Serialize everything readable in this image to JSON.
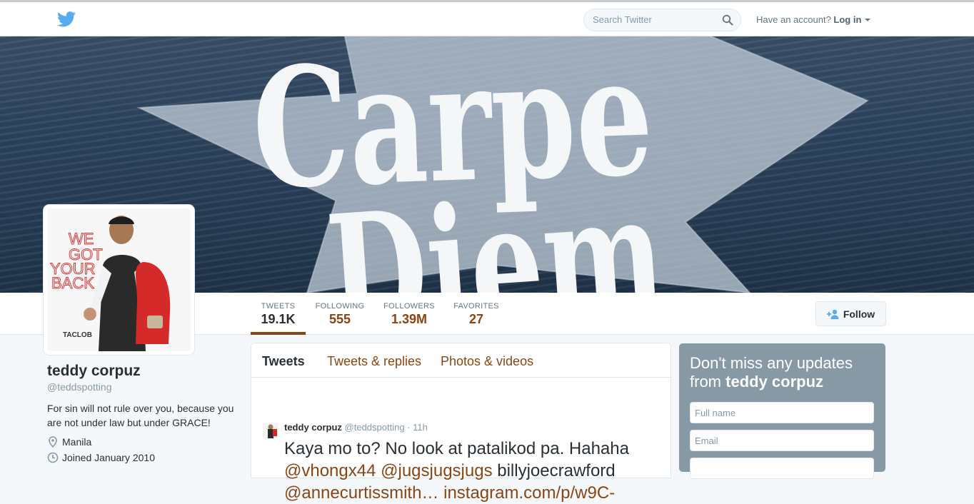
{
  "topbar": {
    "search_placeholder": "Search Twitter",
    "account_prompt": "Have an account?",
    "login_label": "Log in",
    "brand_color": "#55acee"
  },
  "banner": {
    "text_line1": "Carpe",
    "text_line2": "Diem"
  },
  "avatar": {
    "text_lines": [
      "WE",
      "GOT",
      "YOUR",
      "BACK"
    ],
    "brand": "TACLOB"
  },
  "stats": [
    {
      "label": "TWEETS",
      "value": "19.1K"
    },
    {
      "label": "FOLLOWING",
      "value": "555"
    },
    {
      "label": "FOLLOWERS",
      "value": "1.39M"
    },
    {
      "label": "FAVORITES",
      "value": "27"
    }
  ],
  "follow_label": "Follow",
  "profile": {
    "name": "teddy corpuz",
    "handle": "@teddspotting",
    "bio": "For sin will not rule over you, because you are not under law but under GRACE!",
    "location": "Manila",
    "joined": "Joined January 2010"
  },
  "tabs": [
    "Tweets",
    "Tweets & replies",
    "Photos & videos"
  ],
  "tweet": {
    "name": "teddy corpuz",
    "handle": "@teddspotting",
    "time": "· 11h",
    "text_plain": "Kaya mo to? No look at patalikod pa. Hahaha",
    "mention1": "@vhongx44",
    "mention2": "@jugsjugsjugs",
    "text_mid": "billyjoecrawford",
    "mention3": "@annecurtissmith…",
    "link": "instagram.com/p/w9C-"
  },
  "signup": {
    "title_prefix": "Don't miss any updates from",
    "title_name": "teddy corpuz",
    "fullname_placeholder": "Full name",
    "email_placeholder": "Email"
  },
  "colors": {
    "accent": "#8b4513",
    "muted": "#66757f",
    "signup_bg": "#8899a6"
  }
}
